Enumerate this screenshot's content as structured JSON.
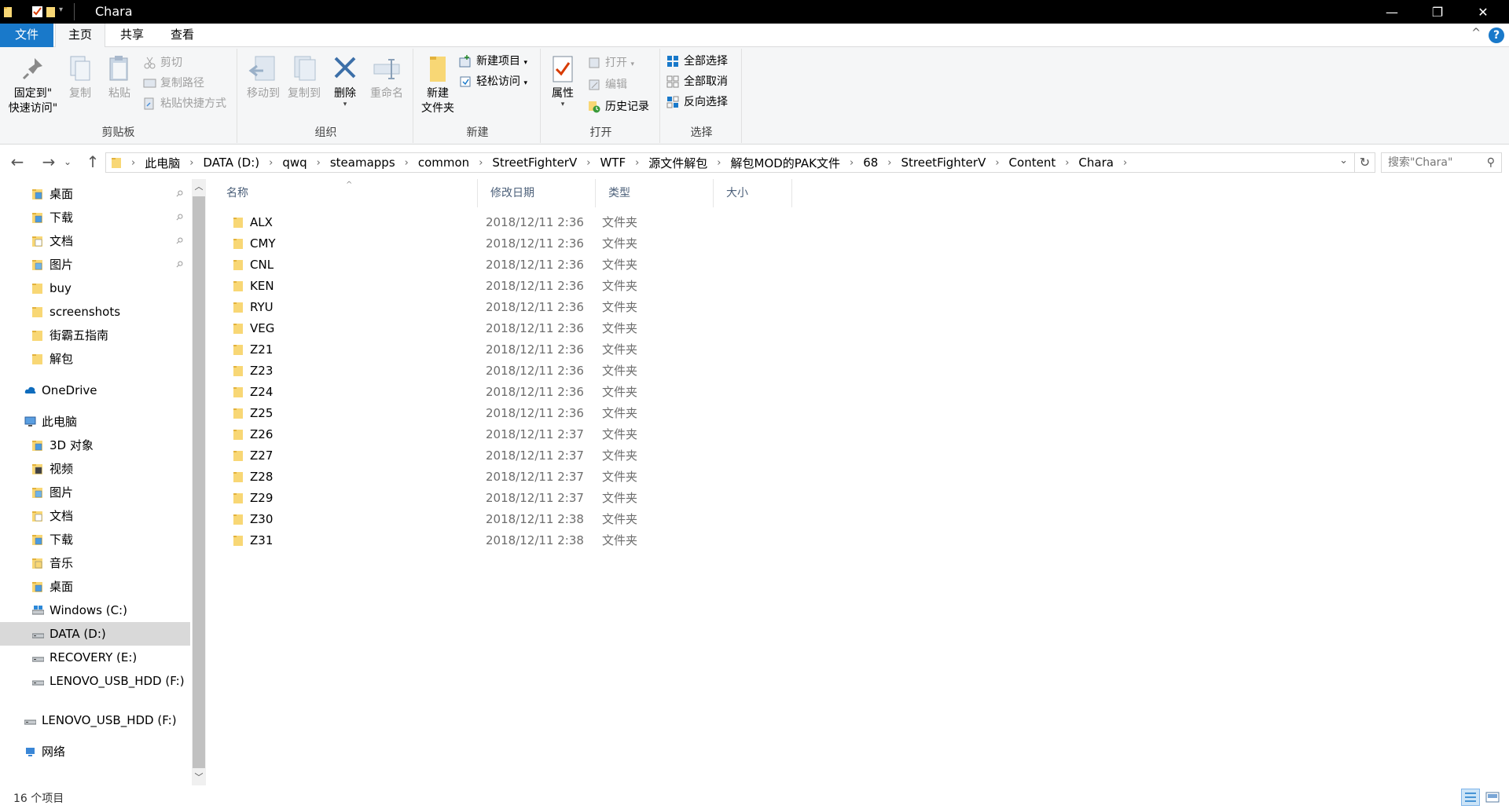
{
  "window": {
    "title": "Chara",
    "minimize_glyph": "—",
    "maximize_glyph": "❐",
    "close_glyph": "✕"
  },
  "ribbon_tabs": {
    "file": "文件",
    "home": "主页",
    "share": "共享",
    "view": "查看",
    "collapse_glyph": "^",
    "help_glyph": "?"
  },
  "ribbon": {
    "clipboard": {
      "label": "剪贴板",
      "pin_line1": "固定到\"",
      "pin_line2": "快速访问\"",
      "copy": "复制",
      "paste": "粘贴",
      "cut": "剪切",
      "copy_path": "复制路径",
      "paste_shortcut": "粘贴快捷方式"
    },
    "organize": {
      "label": "组织",
      "move_to": "移动到",
      "copy_to": "复制到",
      "delete": "删除",
      "rename": "重命名"
    },
    "new": {
      "label": "新建",
      "new_folder_line1": "新建",
      "new_folder_line2": "文件夹",
      "new_item": "新建项目",
      "easy_access": "轻松访问"
    },
    "open": {
      "label": "打开",
      "properties": "属性",
      "open": "打开",
      "edit": "编辑",
      "history": "历史记录"
    },
    "select": {
      "label": "选择",
      "select_all": "全部选择",
      "select_none": "全部取消",
      "invert": "反向选择"
    }
  },
  "address": {
    "crumbs": [
      "此电脑",
      "DATA (D:)",
      "qwq",
      "steamapps",
      "common",
      "StreetFighterV",
      "WTF",
      "源文件解包",
      "解包MOD的PAK文件",
      "68",
      "StreetFighterV",
      "Content",
      "Chara"
    ],
    "separator": "›",
    "search_placeholder": "搜索\"Chara\"",
    "dropdown_glyph": "⌄",
    "refresh_glyph": "↻",
    "back_glyph": "←",
    "forward_glyph": "→",
    "up_glyph": "↑",
    "history_glyph": "⌄",
    "search_icon_glyph": "⚲"
  },
  "nav": {
    "quick": [
      {
        "label": "桌面",
        "pinned": true
      },
      {
        "label": "下载",
        "pinned": true
      },
      {
        "label": "文档",
        "pinned": true
      },
      {
        "label": "图片",
        "pinned": true
      },
      {
        "label": "buy",
        "pinned": false
      },
      {
        "label": "screenshots",
        "pinned": false
      },
      {
        "label": "街霸五指南",
        "pinned": false
      },
      {
        "label": "解包",
        "pinned": false
      }
    ],
    "onedrive": "OneDrive",
    "this_pc": "此电脑",
    "pc_items": [
      "3D 对象",
      "视频",
      "图片",
      "文档",
      "下载",
      "音乐",
      "桌面"
    ],
    "drives": [
      "Windows (C:)",
      "DATA (D:)",
      "RECOVERY (E:)",
      "LENOVO_USB_HDD (F:)"
    ],
    "usb": "LENOVO_USB_HDD (F:)",
    "network": "网络",
    "pin_glyph": "📌"
  },
  "columns": {
    "name": "名称",
    "date": "修改日期",
    "type": "类型",
    "size": "大小",
    "sort_glyph": "^"
  },
  "files": [
    {
      "name": "ALX",
      "date": "2018/12/11 2:36",
      "type": "文件夹"
    },
    {
      "name": "CMY",
      "date": "2018/12/11 2:36",
      "type": "文件夹"
    },
    {
      "name": "CNL",
      "date": "2018/12/11 2:36",
      "type": "文件夹"
    },
    {
      "name": "KEN",
      "date": "2018/12/11 2:36",
      "type": "文件夹"
    },
    {
      "name": "RYU",
      "date": "2018/12/11 2:36",
      "type": "文件夹"
    },
    {
      "name": "VEG",
      "date": "2018/12/11 2:36",
      "type": "文件夹"
    },
    {
      "name": "Z21",
      "date": "2018/12/11 2:36",
      "type": "文件夹"
    },
    {
      "name": "Z23",
      "date": "2018/12/11 2:36",
      "type": "文件夹"
    },
    {
      "name": "Z24",
      "date": "2018/12/11 2:36",
      "type": "文件夹"
    },
    {
      "name": "Z25",
      "date": "2018/12/11 2:36",
      "type": "文件夹"
    },
    {
      "name": "Z26",
      "date": "2018/12/11 2:37",
      "type": "文件夹"
    },
    {
      "name": "Z27",
      "date": "2018/12/11 2:37",
      "type": "文件夹"
    },
    {
      "name": "Z28",
      "date": "2018/12/11 2:37",
      "type": "文件夹"
    },
    {
      "name": "Z29",
      "date": "2018/12/11 2:37",
      "type": "文件夹"
    },
    {
      "name": "Z30",
      "date": "2018/12/11 2:38",
      "type": "文件夹"
    },
    {
      "name": "Z31",
      "date": "2018/12/11 2:38",
      "type": "文件夹"
    }
  ],
  "status": {
    "count": "16 个项目"
  },
  "colors": {
    "accent": "#1979ca",
    "folder": "#f8d775",
    "folder_dark": "#e3b23c",
    "selected": "#d9d9d9"
  }
}
